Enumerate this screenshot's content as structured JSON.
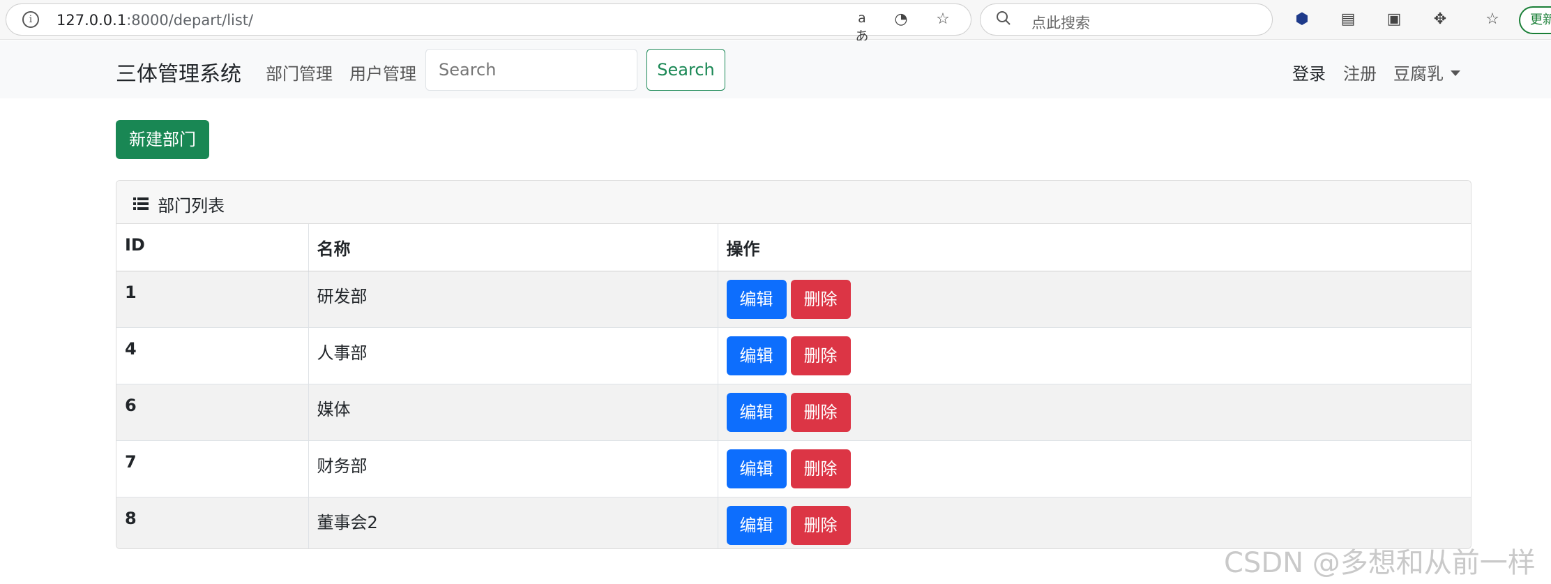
{
  "browser": {
    "url_host": "127.0.0.1",
    "url_path": ":8000/depart/list/",
    "search_placeholder": "点此搜索",
    "update_label": "更新"
  },
  "navbar": {
    "brand": "三体管理系统",
    "links": [
      "部门管理",
      "用户管理"
    ],
    "search_placeholder": "Search",
    "search_button": "Search",
    "login": "登录",
    "register": "注册",
    "user": "豆腐乳"
  },
  "actions": {
    "new_department": "新建部门"
  },
  "panel": {
    "title": "部门列表",
    "columns": [
      "ID",
      "名称",
      "操作"
    ],
    "rows": [
      {
        "id": "1",
        "name": "研发部"
      },
      {
        "id": "4",
        "name": "人事部"
      },
      {
        "id": "6",
        "name": "媒体"
      },
      {
        "id": "7",
        "name": "财务部"
      },
      {
        "id": "8",
        "name": "董事会2"
      }
    ],
    "edit_label": "编辑",
    "delete_label": "删除"
  },
  "watermark": "CSDN @多想和从前一样",
  "colors": {
    "success": "#198754",
    "primary": "#0d6efd",
    "danger": "#dc3545"
  }
}
